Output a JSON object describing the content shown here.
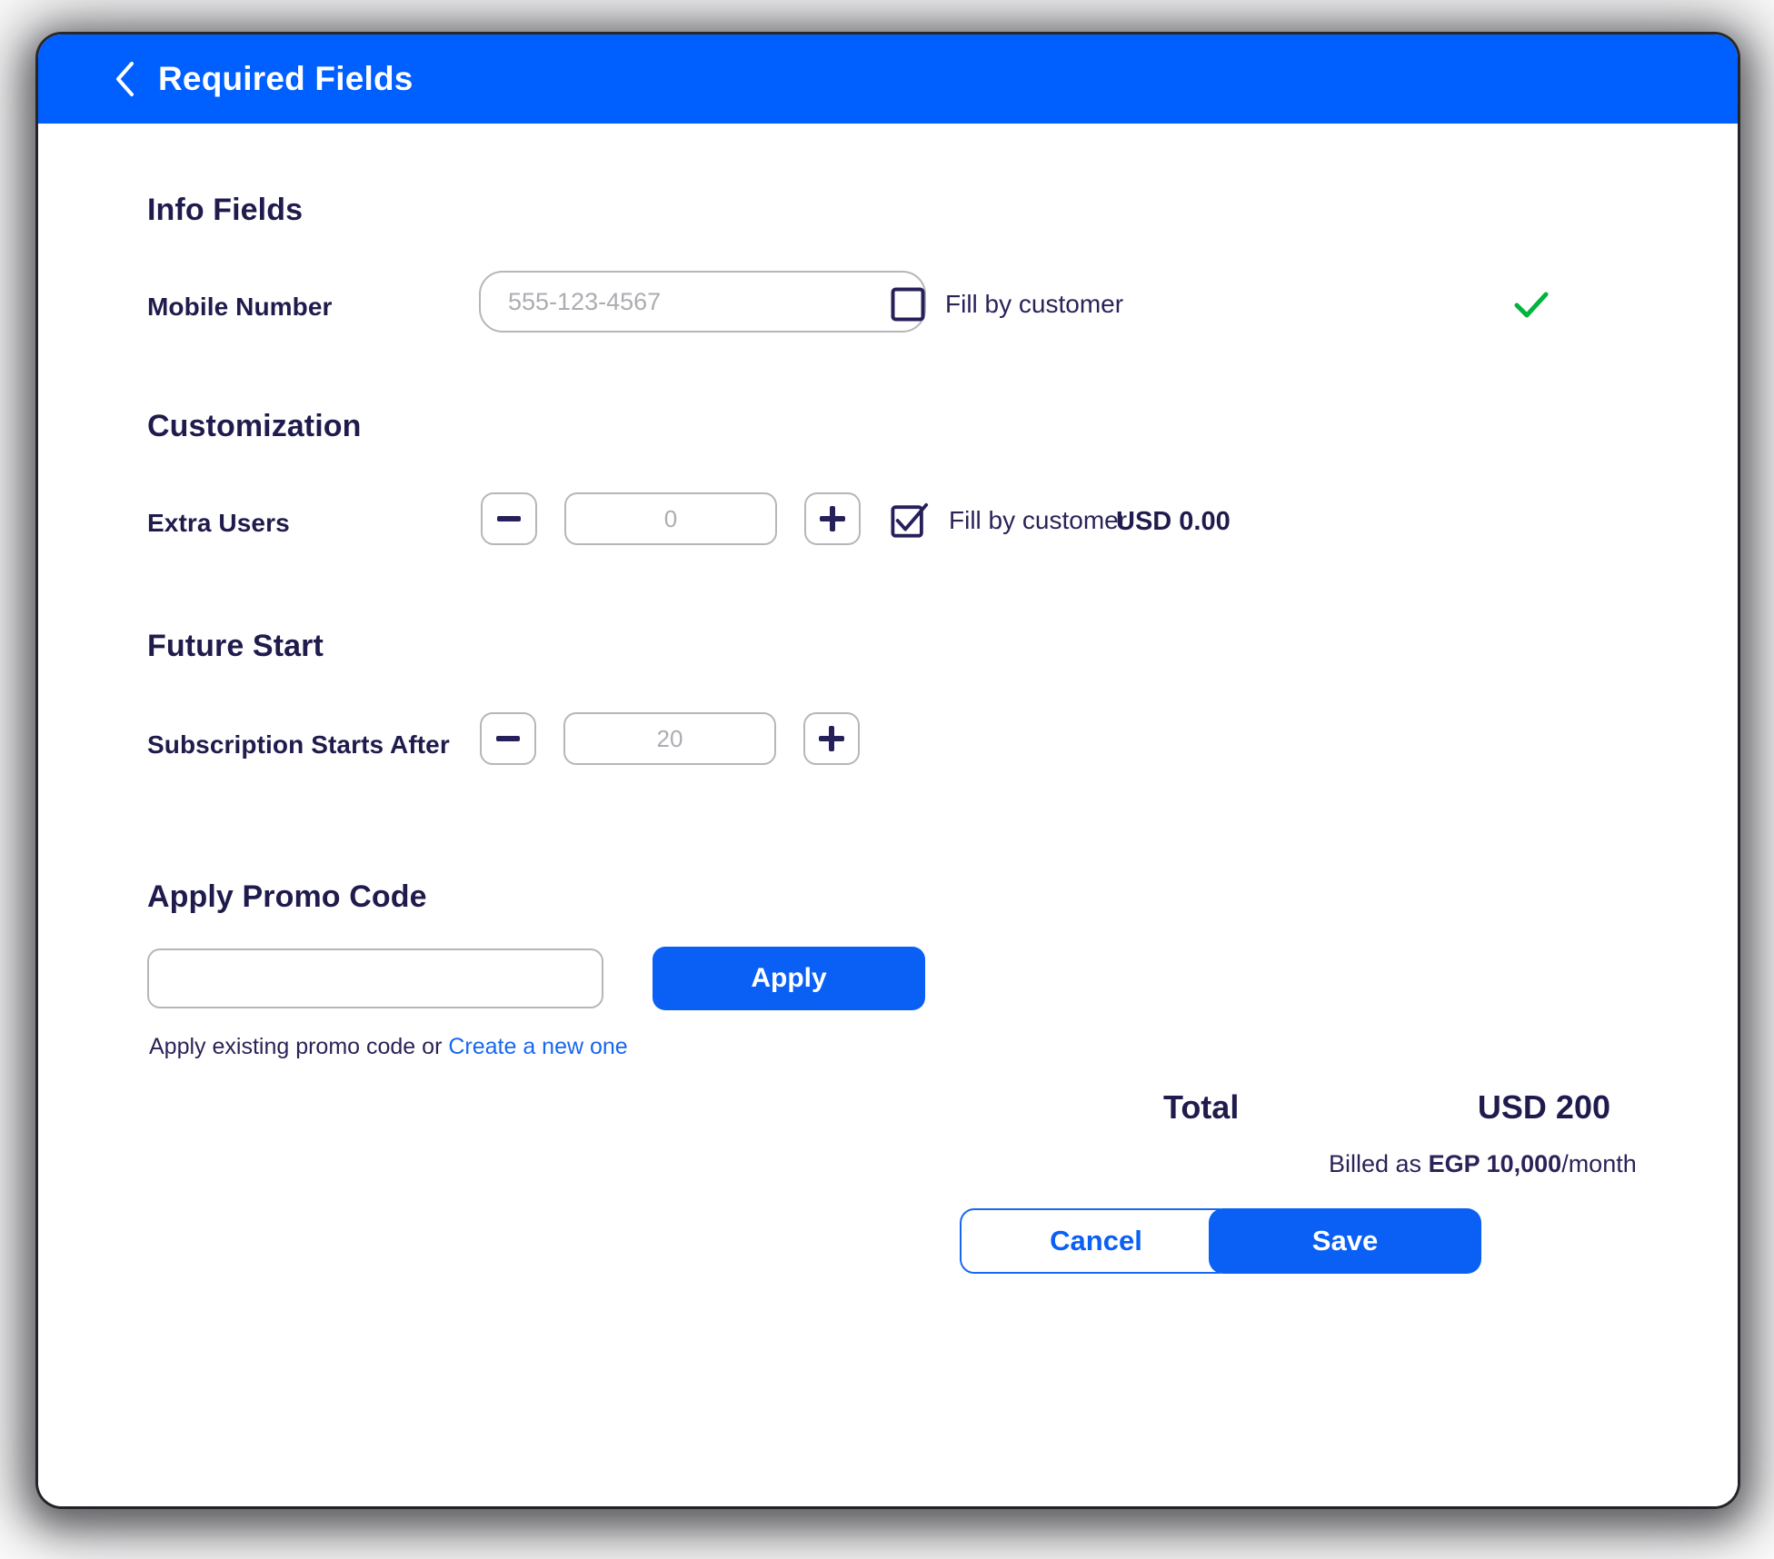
{
  "header": {
    "title": "Required Fields",
    "back_icon": "chevron-left-icon",
    "bar_color": "#0060ff"
  },
  "colors": {
    "brand_blue": "#0060ff",
    "button_blue": "#0a5ff5",
    "link_blue": "#1767f0",
    "navy_text": "#1f1b4d",
    "success_green": "#00b43c",
    "border_gray": "#b6b6bb",
    "placeholder_gray": "#acacb2"
  },
  "sections": {
    "info_fields": {
      "title": "Info Fields",
      "mobile": {
        "label": "Mobile Number",
        "placeholder": "555-123-4567",
        "value": "",
        "fill_by_customer_label": "Fill by customer",
        "fill_by_customer_checked": false,
        "status_icon": "check-icon"
      }
    },
    "customization": {
      "title": "Customization",
      "extra_users": {
        "label": "Extra Users",
        "placeholder": "0",
        "value": "",
        "decrement_icon": "minus-icon",
        "increment_icon": "plus-icon",
        "fill_by_customer_label": "Fill by customer",
        "fill_by_customer_checked": true,
        "price": "USD 0.00"
      }
    },
    "future_start": {
      "title": "Future Start",
      "subscription_starts_after": {
        "label": "Subscription Starts After",
        "placeholder": "20",
        "value": "",
        "decrement_icon": "minus-icon",
        "increment_icon": "plus-icon"
      }
    },
    "promo": {
      "title": "Apply Promo Code",
      "input_placeholder": "",
      "input_value": "",
      "apply_label": "Apply",
      "hint_prefix": "Apply existing promo code or ",
      "hint_link": "Create a new one"
    }
  },
  "totals": {
    "label": "Total",
    "value": "USD 200",
    "billed_prefix": "Billed as ",
    "billed_amount": "EGP 10,000",
    "billed_suffix": "/month"
  },
  "footer": {
    "cancel_label": "Cancel",
    "save_label": "Save"
  }
}
